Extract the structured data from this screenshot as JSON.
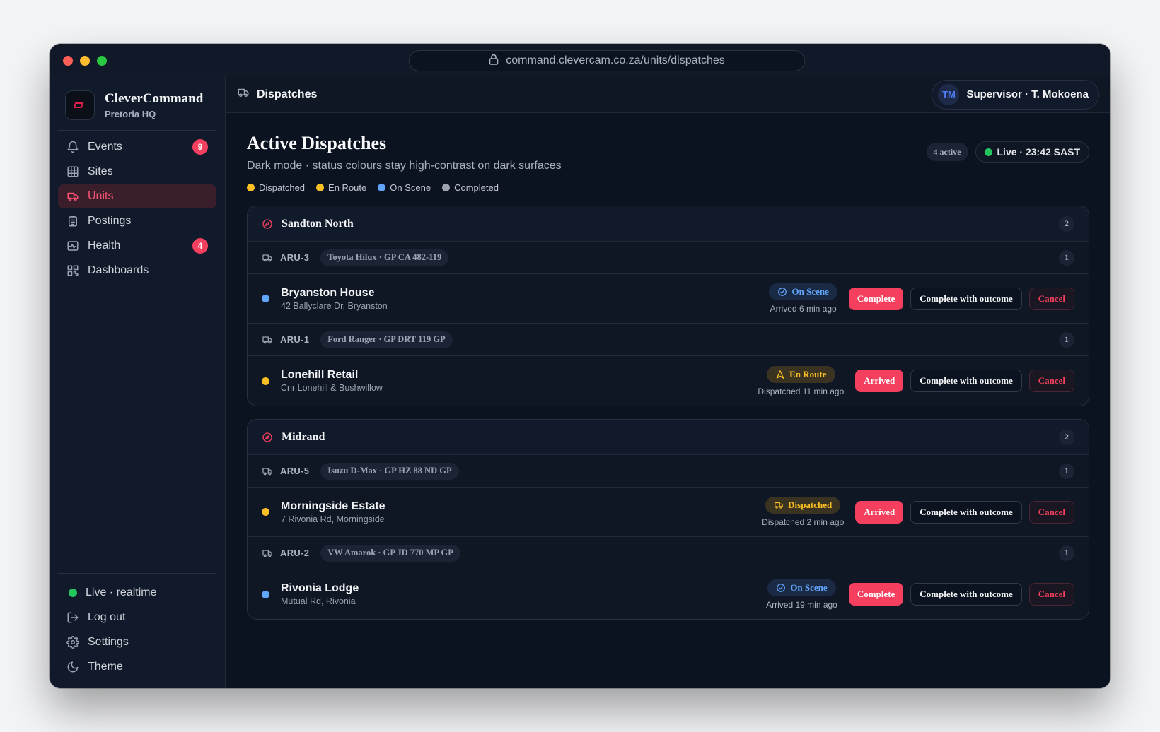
{
  "browser": {
    "url": "command.clevercam.co.za/units/dispatches"
  },
  "brand": {
    "name": "CleverCommand",
    "location": "Pretoria HQ"
  },
  "nav": {
    "items": [
      {
        "label": "Events",
        "badge": "9",
        "icon": "bell-icon"
      },
      {
        "label": "Sites",
        "badge": "",
        "icon": "building-icon"
      },
      {
        "label": "Units",
        "badge": "",
        "icon": "truck-icon",
        "active": true
      },
      {
        "label": "Postings",
        "badge": "",
        "icon": "clipboard-icon"
      },
      {
        "label": "Health",
        "badge": "4",
        "icon": "activity-icon"
      },
      {
        "label": "Dashboards",
        "badge": "",
        "icon": "grid-icon"
      }
    ],
    "bottom": {
      "live": "Live · realtime",
      "logout": "Log out",
      "settings": "Settings",
      "theme": "Theme"
    }
  },
  "topbar": {
    "title": "Dispatches",
    "user_initials": "TM",
    "user_name": "Supervisor · T. Mokoena"
  },
  "page": {
    "title": "Active Dispatches",
    "subtitle": "Dark mode · status colours stay high-contrast on dark surfaces",
    "active_count": "4 active",
    "live_label": "Live · 23:42 SAST",
    "legend": [
      {
        "label": "Dispatched",
        "color": "#fbbf24"
      },
      {
        "label": "En Route",
        "color": "#fbbf24"
      },
      {
        "label": "On Scene",
        "color": "#60a5fa"
      },
      {
        "label": "Completed",
        "color": "#9ca3af"
      }
    ]
  },
  "groups": [
    {
      "name": "Sandton North",
      "count": "2",
      "units": [
        {
          "id": "ARU-3",
          "vehicle": "Toyota Hilux · GP CA 482-119",
          "count": "1",
          "site": "Bryanston House",
          "address": "42 Ballyclare Dr, Bryanston",
          "status": "On Scene",
          "status_kind": "onscene",
          "status_color": "#60a5fa",
          "time": "Arrived 6 min ago",
          "primary": "Complete",
          "secondary": "Complete with outcome",
          "cancel": "Cancel"
        },
        {
          "id": "ARU-1",
          "vehicle": "Ford Ranger · GP DRT 119 GP",
          "count": "1",
          "site": "Lonehill Retail",
          "address": "Cnr Lonehill & Bushwillow",
          "status": "En Route",
          "status_kind": "enroute",
          "status_color": "#fbbf24",
          "time": "Dispatched 11 min ago",
          "primary": "Arrived",
          "secondary": "Complete with outcome",
          "cancel": "Cancel"
        }
      ]
    },
    {
      "name": "Midrand",
      "count": "2",
      "units": [
        {
          "id": "ARU-5",
          "vehicle": "Isuzu D-Max · GP HZ 88 ND GP",
          "count": "1",
          "site": "Morningside Estate",
          "address": "7 Rivonia Rd, Morningside",
          "status": "Dispatched",
          "status_kind": "dispatched",
          "status_color": "#fbbf24",
          "time": "Dispatched 2 min ago",
          "primary": "Arrived",
          "secondary": "Complete with outcome",
          "cancel": "Cancel"
        },
        {
          "id": "ARU-2",
          "vehicle": "VW Amarok · GP JD 770 MP GP",
          "count": "1",
          "site": "Rivonia Lodge",
          "address": "Mutual Rd, Rivonia",
          "status": "On Scene",
          "status_kind": "onscene",
          "status_color": "#60a5fa",
          "time": "Arrived 19 min ago",
          "primary": "Complete",
          "secondary": "Complete with outcome",
          "cancel": "Cancel"
        }
      ]
    }
  ]
}
